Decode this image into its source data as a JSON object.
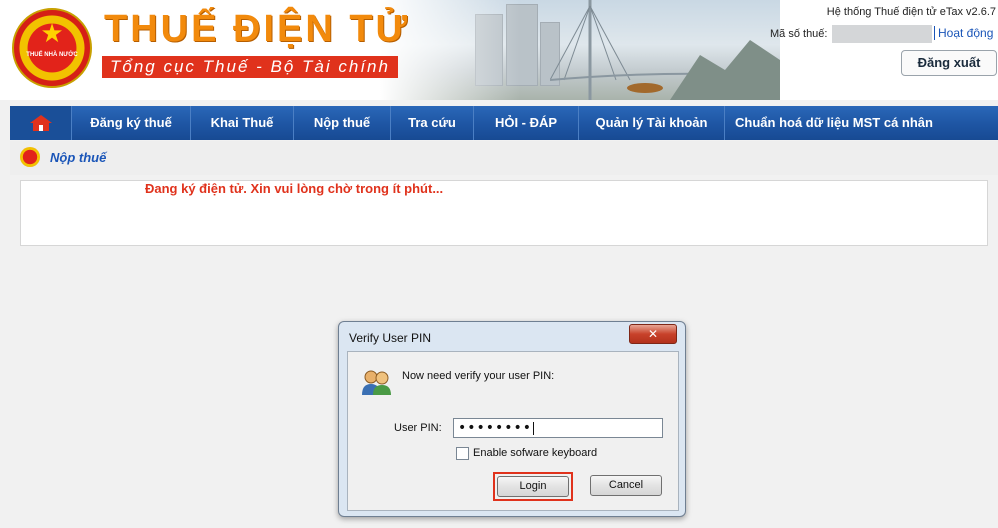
{
  "header": {
    "brand_title": "THUẾ ĐIỆN TỬ",
    "brand_subtitle": "Tổng cục Thuế - Bộ Tài chính",
    "emblem_text": "THUẾ NHÀ NƯỚC",
    "system_version": "Hệ thống Thuế điện tử eTax v2.6.7",
    "tax_code_label": "Mã số thuế:",
    "tax_code_value": "",
    "activity_link": "Hoạt động",
    "logout_label": "Đăng xuất"
  },
  "nav": {
    "home_icon": "home-icon",
    "items": [
      {
        "label": "Đăng ký thuế"
      },
      {
        "label": "Khai Thuế"
      },
      {
        "label": "Nộp thuế"
      },
      {
        "label": "Tra cứu"
      },
      {
        "label": "HỎI - ĐÁP"
      },
      {
        "label": "Quản lý Tài khoản"
      },
      {
        "label": "Chuẩn hoá dữ liệu MST cá nhân"
      }
    ]
  },
  "breadcrumb": {
    "label": "Nộp thuế"
  },
  "content": {
    "status_message": "Đang ký điện tử. Xin vui lòng chờ trong ít phút..."
  },
  "dialog": {
    "title": "Verify User PIN",
    "close_icon": "close-icon",
    "prompt": "Now need verify your user PIN:",
    "pin_label": "User PIN:",
    "pin_value": "••••••••",
    "keyboard_checkbox_label": "Enable sofware keyboard",
    "keyboard_checkbox_checked": false,
    "login_label": "Login",
    "cancel_label": "Cancel"
  },
  "colors": {
    "nav_blue": "#1e55a3",
    "brand_orange": "#f28a0c",
    "brand_red": "#e0321c",
    "link_blue": "#1a55b8"
  }
}
